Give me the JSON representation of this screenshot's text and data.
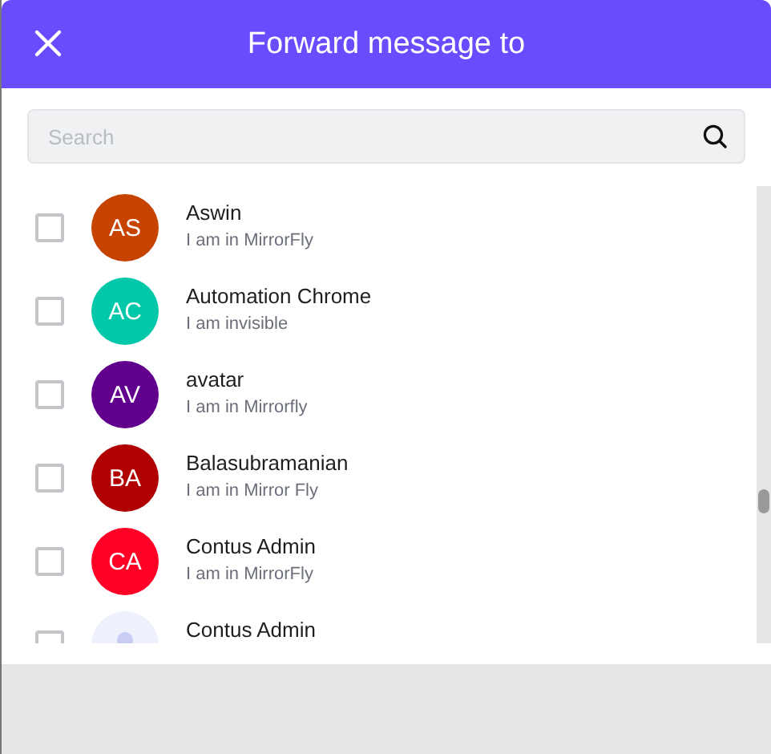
{
  "header": {
    "title": "Forward message to"
  },
  "search": {
    "placeholder": "Search"
  },
  "contacts": [
    {
      "kind": "initials",
      "initials": "AS",
      "color": "#c74300",
      "name": "Aswin",
      "status": "I am in MirrorFly",
      "checked": false
    },
    {
      "kind": "initials",
      "initials": "AC",
      "color": "#00c8a8",
      "name": "Automation Chrome",
      "status": "I am invisible",
      "checked": false
    },
    {
      "kind": "initials",
      "initials": "AV",
      "color": "#62008e",
      "name": "avatar",
      "status": "I am in Mirrorfly",
      "checked": false
    },
    {
      "kind": "initials",
      "initials": "BA",
      "color": "#b00000",
      "name": "Balasubramanian",
      "status": "I am in Mirror Fly",
      "checked": false
    },
    {
      "kind": "initials",
      "initials": "CA",
      "color": "#ff0026",
      "name": "Contus Admin",
      "status": "I am in MirrorFly",
      "checked": false
    },
    {
      "kind": "placeholder",
      "name": "Contus Admin",
      "checked": false
    }
  ]
}
